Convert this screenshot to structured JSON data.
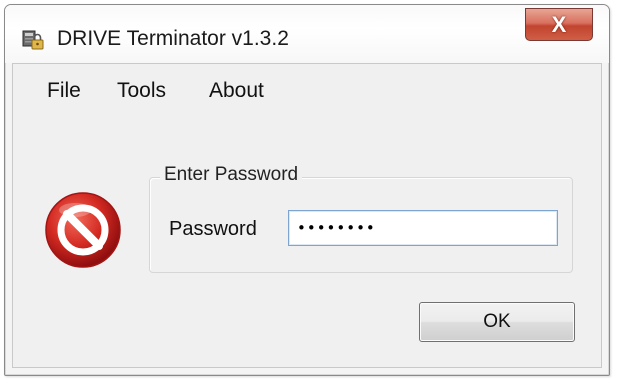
{
  "window": {
    "title": "DRIVE Terminator v1.3.2",
    "app_icon": "drive-lock-icon",
    "close_symbol": "X"
  },
  "menu": {
    "items": [
      {
        "label": "File"
      },
      {
        "label": "Tools"
      },
      {
        "label": "About"
      }
    ]
  },
  "dialog": {
    "status_icon": "stop-icon",
    "group_title": "Enter Password",
    "password_label": "Password",
    "password_value": "••••••••",
    "ok_label": "OK"
  },
  "colors": {
    "close_button": "#c7412d",
    "stop_icon": "#c51a1a",
    "input_border": "#7ea5cf"
  }
}
